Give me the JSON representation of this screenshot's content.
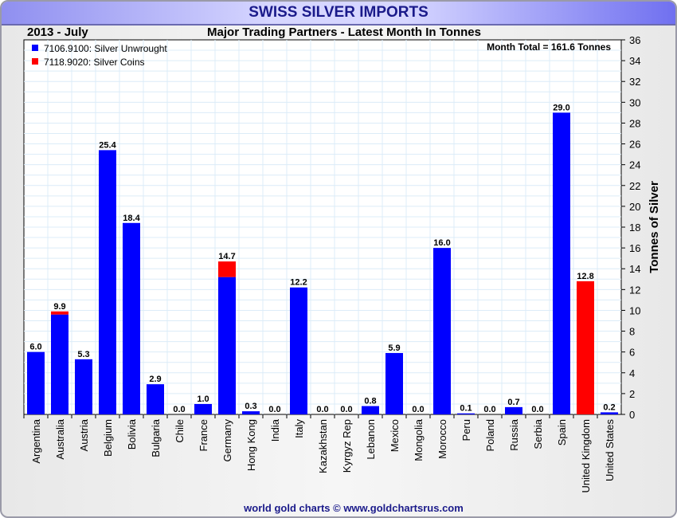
{
  "header": {
    "title": "SWISS SILVER IMPORTS",
    "period": "2013 - July",
    "subtitle": "Major Trading Partners - Latest Month In Tonnes",
    "month_total": "Month Total = 161.6 Tonnes",
    "footer": "world gold charts © www.goldchartsrus.com"
  },
  "chart_data": {
    "type": "bar",
    "stacked": true,
    "title": "SWISS SILVER IMPORTS",
    "subtitle": "Major Trading Partners - Latest Month In Tonnes",
    "ylabel": "Tonnes of Silver",
    "ylim": [
      0,
      36
    ],
    "yticks": [
      0,
      2,
      4,
      6,
      8,
      10,
      12,
      14,
      16,
      18,
      20,
      22,
      24,
      26,
      28,
      30,
      32,
      34,
      36
    ],
    "grid": true,
    "legend": "top-left",
    "categories": [
      "Argentina",
      "Australia",
      "Austria",
      "Belgium",
      "Bolivia",
      "Bulgaria",
      "Chile",
      "France",
      "Germany",
      "Hong Kong",
      "India",
      "Italy",
      "Kazakhstan",
      "Kyrgyz Rep",
      "Lebanon",
      "Mexico",
      "Mongolia",
      "Morocco",
      "Peru",
      "Poland",
      "Russia",
      "Serbia",
      "Spain",
      "United Kingdom",
      "United States"
    ],
    "series": [
      {
        "name": "7106.9100: Silver Unwrought",
        "color": "#0000ff",
        "values": [
          6.0,
          9.6,
          5.3,
          25.4,
          18.4,
          2.9,
          0.0,
          1.0,
          13.2,
          0.3,
          0.0,
          12.2,
          0.0,
          0.0,
          0.8,
          5.9,
          0.0,
          16.0,
          0.1,
          0.0,
          0.7,
          0.0,
          29.0,
          0.0,
          0.2
        ]
      },
      {
        "name": "7118.9020: Silver Coins",
        "color": "#ff0000",
        "values": [
          0,
          0.3,
          0,
          0,
          0,
          0,
          0,
          0,
          1.5,
          0,
          0,
          0,
          0,
          0,
          0,
          0,
          0,
          0,
          0,
          0,
          0,
          0,
          0,
          12.8,
          0
        ]
      }
    ],
    "labels": [
      "6.0",
      "9.9",
      "5.3",
      "25.4",
      "18.4",
      "2.9",
      "0.0",
      "1.0",
      "14.7",
      "0.3",
      "0.0",
      "12.2",
      "0.0",
      "0.0",
      "0.8",
      "5.9",
      "0.0",
      "16.0",
      "0.1",
      "0.0",
      "0.7",
      "0.0",
      "29.0",
      "12.8",
      "0.2"
    ]
  }
}
